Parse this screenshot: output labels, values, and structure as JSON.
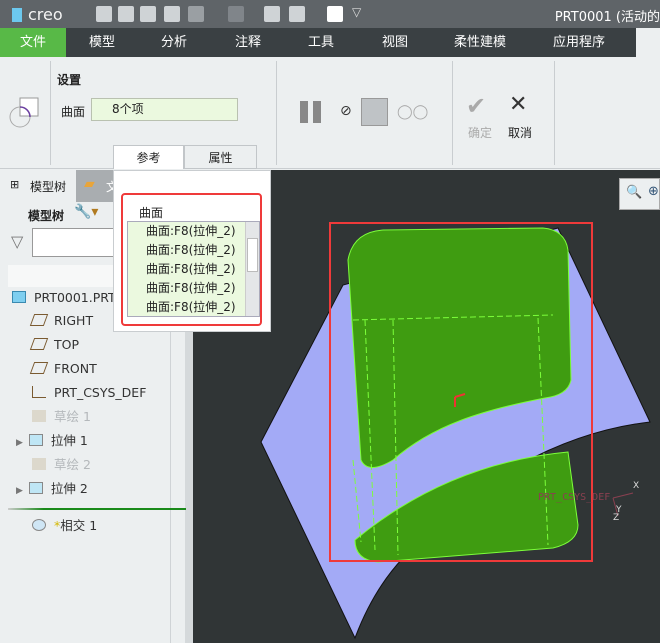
{
  "app": {
    "logo": "creo",
    "window_title": "PRT0001 (活动的"
  },
  "menu": [
    "文件",
    "模型",
    "分析",
    "注释",
    "工具",
    "视图",
    "柔性建模",
    "应用程序"
  ],
  "ribbon": {
    "group_label": "设置",
    "surface_label": "曲面",
    "surface_value": "8个项",
    "ok_label": "确定",
    "cancel_label": "取消"
  },
  "tabs": {
    "references": "参考",
    "properties": "属性"
  },
  "popup": {
    "title": "曲面",
    "items": [
      "曲面:F8(拉伸_2)",
      "曲面:F8(拉伸_2)",
      "曲面:F8(拉伸_2)",
      "曲面:F8(拉伸_2)",
      "曲面:F8(拉伸_2)"
    ]
  },
  "panel": {
    "tab_model_tree": "模型树",
    "tab_files": "文",
    "toolbar_label": "模型树"
  },
  "tree": [
    {
      "label": "PRT0001.PRT",
      "icon": "part-icon"
    },
    {
      "label": "RIGHT",
      "icon": "datum-plane-icon"
    },
    {
      "label": "TOP",
      "icon": "datum-plane-icon"
    },
    {
      "label": "FRONT",
      "icon": "datum-plane-icon"
    },
    {
      "label": "PRT_CSYS_DEF",
      "icon": "csys-icon"
    },
    {
      "label": "草绘 1",
      "icon": "sketch-icon"
    },
    {
      "label": "拉伸 1",
      "icon": "extrude-icon"
    },
    {
      "label": "草绘 2",
      "icon": "sketch-icon"
    },
    {
      "label": "拉伸 2",
      "icon": "extrude-icon"
    }
  ],
  "insert_item": {
    "mark": "*",
    "label": "相交 1"
  },
  "viewport": {
    "csys_label": "PRT_CSYS_DEF",
    "axis_x": "X",
    "axis_y": "Y",
    "axis_z": "Z"
  },
  "colors": {
    "accent": "#58b947",
    "surface": "#a3aaf6",
    "solid": "#3a9a10",
    "selection": "#ef3a3a"
  }
}
